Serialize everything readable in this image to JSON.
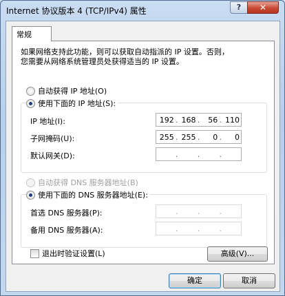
{
  "window": {
    "title": "Internet 协议版本 4 (TCP/IPv4) 属性",
    "help_label": "?",
    "close_label": "✕"
  },
  "tab": {
    "label": "常规"
  },
  "intro": {
    "line1": "如果网络支持此功能，则可以获取自动指派的 IP 设置。否则，",
    "line2": "您需要从网络系统管理员处获得适当的 IP 设置。"
  },
  "ip_section": {
    "auto_radio": "自动获得 IP 地址(O)",
    "manual_radio": "使用下面的 IP 地址(S):",
    "ip_label": "IP 地址(I):",
    "mask_label": "子网掩码(U):",
    "gateway_label": "默认网关(D):",
    "ip_octets": [
      "192",
      "168",
      "56",
      "110"
    ],
    "mask_octets": [
      "255",
      "255",
      "0",
      "0"
    ],
    "gateway_octets": [
      "",
      "",
      "",
      ""
    ]
  },
  "dns_section": {
    "auto_radio": "自动获得 DNS 服务器地址(B)",
    "manual_radio": "使用下面的 DNS 服务器地址(E):",
    "preferred_label": "首选 DNS 服务器(P):",
    "alternate_label": "备用 DNS 服务器(A):",
    "preferred_octets": [
      "",
      "",
      "",
      ""
    ],
    "alternate_octets": [
      "",
      "",
      "",
      ""
    ]
  },
  "validate_checkbox": "退出时验证设置(L)",
  "advanced_button": "高级(V)...",
  "ok_button": "确定",
  "cancel_button": "取消"
}
